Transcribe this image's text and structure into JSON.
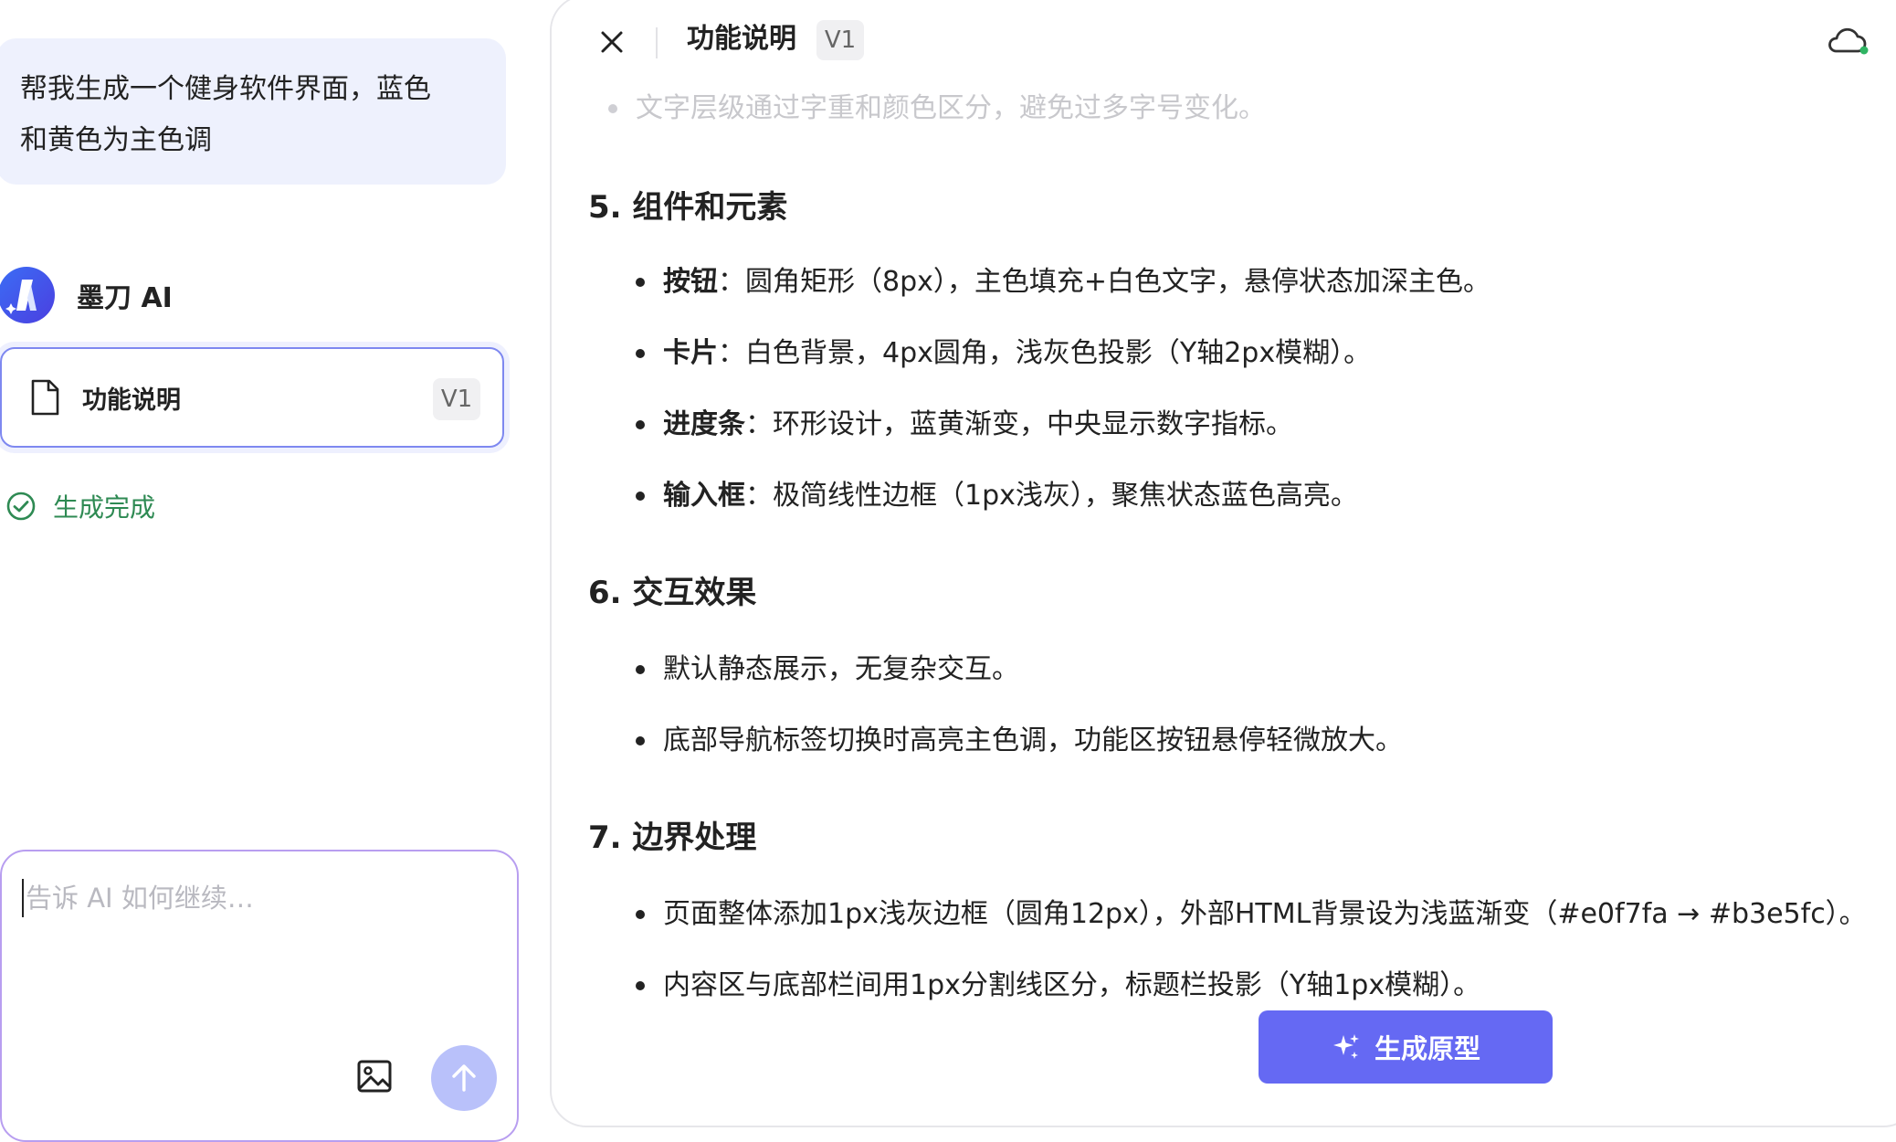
{
  "chat": {
    "user_message_line1": "帮我生成一个健身软件界面，蓝色",
    "user_message_line2": "和黄色为主色调",
    "ai_name": "墨刀 AI",
    "doc_card": {
      "title": "功能说明",
      "version": "V1"
    },
    "status": "生成完成",
    "input": {
      "placeholder": "告诉 AI 如何继续…",
      "value": ""
    }
  },
  "doc_panel": {
    "title": "功能说明",
    "version": "V1",
    "faded_line": "文字层级通过字重和颜色区分，避免过多字号变化。",
    "sections": [
      {
        "heading": "5. 组件和元素",
        "bullets": [
          {
            "bold": "按钮",
            "text": "：圆角矩形（8px），主色填充+白色文字，悬停状态加深主色。"
          },
          {
            "bold": "卡片",
            "text": "：白色背景，4px圆角，浅灰色投影（Y轴2px模糊）。"
          },
          {
            "bold": "进度条",
            "text": "：环形设计，蓝黄渐变，中央显示数字指标。"
          },
          {
            "bold": "输入框",
            "text": "：极简线性边框（1px浅灰），聚焦状态蓝色高亮。"
          }
        ]
      },
      {
        "heading": "6. 交互效果",
        "bullets": [
          {
            "bold": "",
            "text": "默认静态展示，无复杂交互。"
          },
          {
            "bold": "",
            "text": "底部导航标签切换时高亮主色调，功能区按钮悬停轻微放大。"
          }
        ]
      },
      {
        "heading": "7. 边界处理",
        "bullets": [
          {
            "bold": "",
            "text": "页面整体添加1px浅灰边框（圆角12px），外部HTML背景设为浅蓝渐变（#e0f7fa → #b3e5fc）。"
          },
          {
            "bold": "",
            "text": "内容区与底部栏间用1px分割线区分，标题栏投影（Y轴1px模糊）。"
          }
        ]
      }
    ],
    "generate_button": "生成原型"
  },
  "colors": {
    "accent": "#6569f3",
    "user_bubble_bg": "#eef1fd",
    "status_green": "#2e8a53",
    "send_button": "#b9c1fa"
  }
}
